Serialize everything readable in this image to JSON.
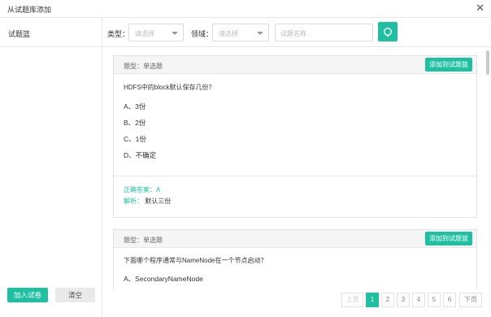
{
  "dialog": {
    "title": "从试题库添加",
    "close_icon": "close-icon"
  },
  "left": {
    "header": "试题篮",
    "join_label": "加入试卷",
    "clear_label": "清空"
  },
  "filters": {
    "type_label": "类型：",
    "type_placeholder": "请选择",
    "domain_label": "领域：",
    "domain_placeholder": "请选择",
    "name_placeholder": "试题名称",
    "search_icon": "search-icon"
  },
  "questions": [
    {
      "type_label": "题型：单选题",
      "add_label": "添加到试题篮",
      "text": "HDFS中的block默认保存几份？",
      "options": [
        "A、3份",
        "B、2份",
        "C、1份",
        "D、不确定"
      ],
      "answer": "正确答案：A",
      "analysis_key": "解析：",
      "analysis_value": "默认三份"
    },
    {
      "type_label": "题型：单选题",
      "add_label": "添加到试题篮",
      "text": "下面哪个程序通常与NameNode在一个节点启动？",
      "options": [
        "A、SecondaryNameNode"
      ]
    }
  ],
  "pager": {
    "prev": "上页",
    "pages": [
      "1",
      "2",
      "3",
      "4",
      "5",
      "6"
    ],
    "current": "1",
    "next": "下页"
  },
  "colors": {
    "accent": "#1fbfa1"
  }
}
